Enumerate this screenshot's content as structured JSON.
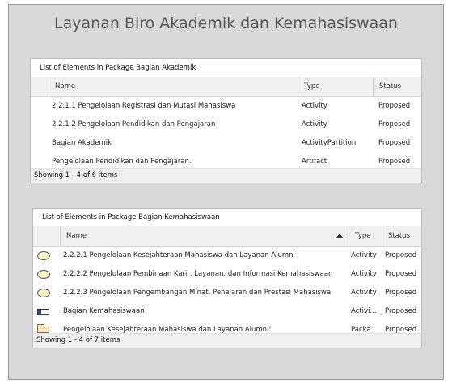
{
  "page": {
    "title": "Layanan Biro Akademik dan Kemahasiswaan"
  },
  "panel1": {
    "title": "List of Elements in Package Bagian Akademik",
    "columns": {
      "name": "Name",
      "type": "Type",
      "status": "Status"
    },
    "rows": [
      {
        "name": "2.2.1.1 Pengelolaan Registrasi dan Mutasi Mahasiswa",
        "type": "Activity",
        "status": "Proposed"
      },
      {
        "name": "2.2.1.2 Pengelolaan Pendidikan dan Pengajaran",
        "type": "Activity",
        "status": "Proposed"
      },
      {
        "name": "Bagian Akademik",
        "type": "ActivityPartition",
        "status": "Proposed"
      },
      {
        "name": "Pengelolaan Pendidikan dan Pengajaran.",
        "type": "Artifact",
        "status": "Proposed"
      }
    ],
    "footer": "Showing 1 - 4 of 6 items"
  },
  "panel2": {
    "title": "List of Elements in Package Bagian Kemahasiswaan",
    "columns": {
      "name": "Name",
      "type": "Type",
      "status": "Status"
    },
    "sort_icon": "sort-ascending-icon",
    "rows": [
      {
        "icon": "activity-icon",
        "name": "2.2.2.1 Pengelolaan Kesejahteraan Mahasiswa dan Layanan Alumni",
        "type": "Activity",
        "status": "Proposed"
      },
      {
        "icon": "activity-icon",
        "name": "2.2.2.2 Pengelolaan Pembinaan Karir, Layanan, dan Informasi Kemahasiswaan",
        "type": "Activity",
        "status": "Proposed"
      },
      {
        "icon": "activity-icon",
        "name": "2.2.2.3 Pengelolaan Pengembangan Minat, Penalaran dan Prestasi Mahasiswa",
        "type": "Activity",
        "status": "Proposed"
      },
      {
        "icon": "activity-partition-icon",
        "name": "Bagian Kemahasiswaan",
        "type": "Activi...",
        "status": "Proposed"
      },
      {
        "icon": "package-icon",
        "name": "Pengelolaan Kesejahteraan Mahasiswa dan Layanan Alumni:",
        "type": "Packa",
        "status": "Proposed"
      }
    ],
    "footer": "Showing 1 - 4 of 7 items"
  }
}
